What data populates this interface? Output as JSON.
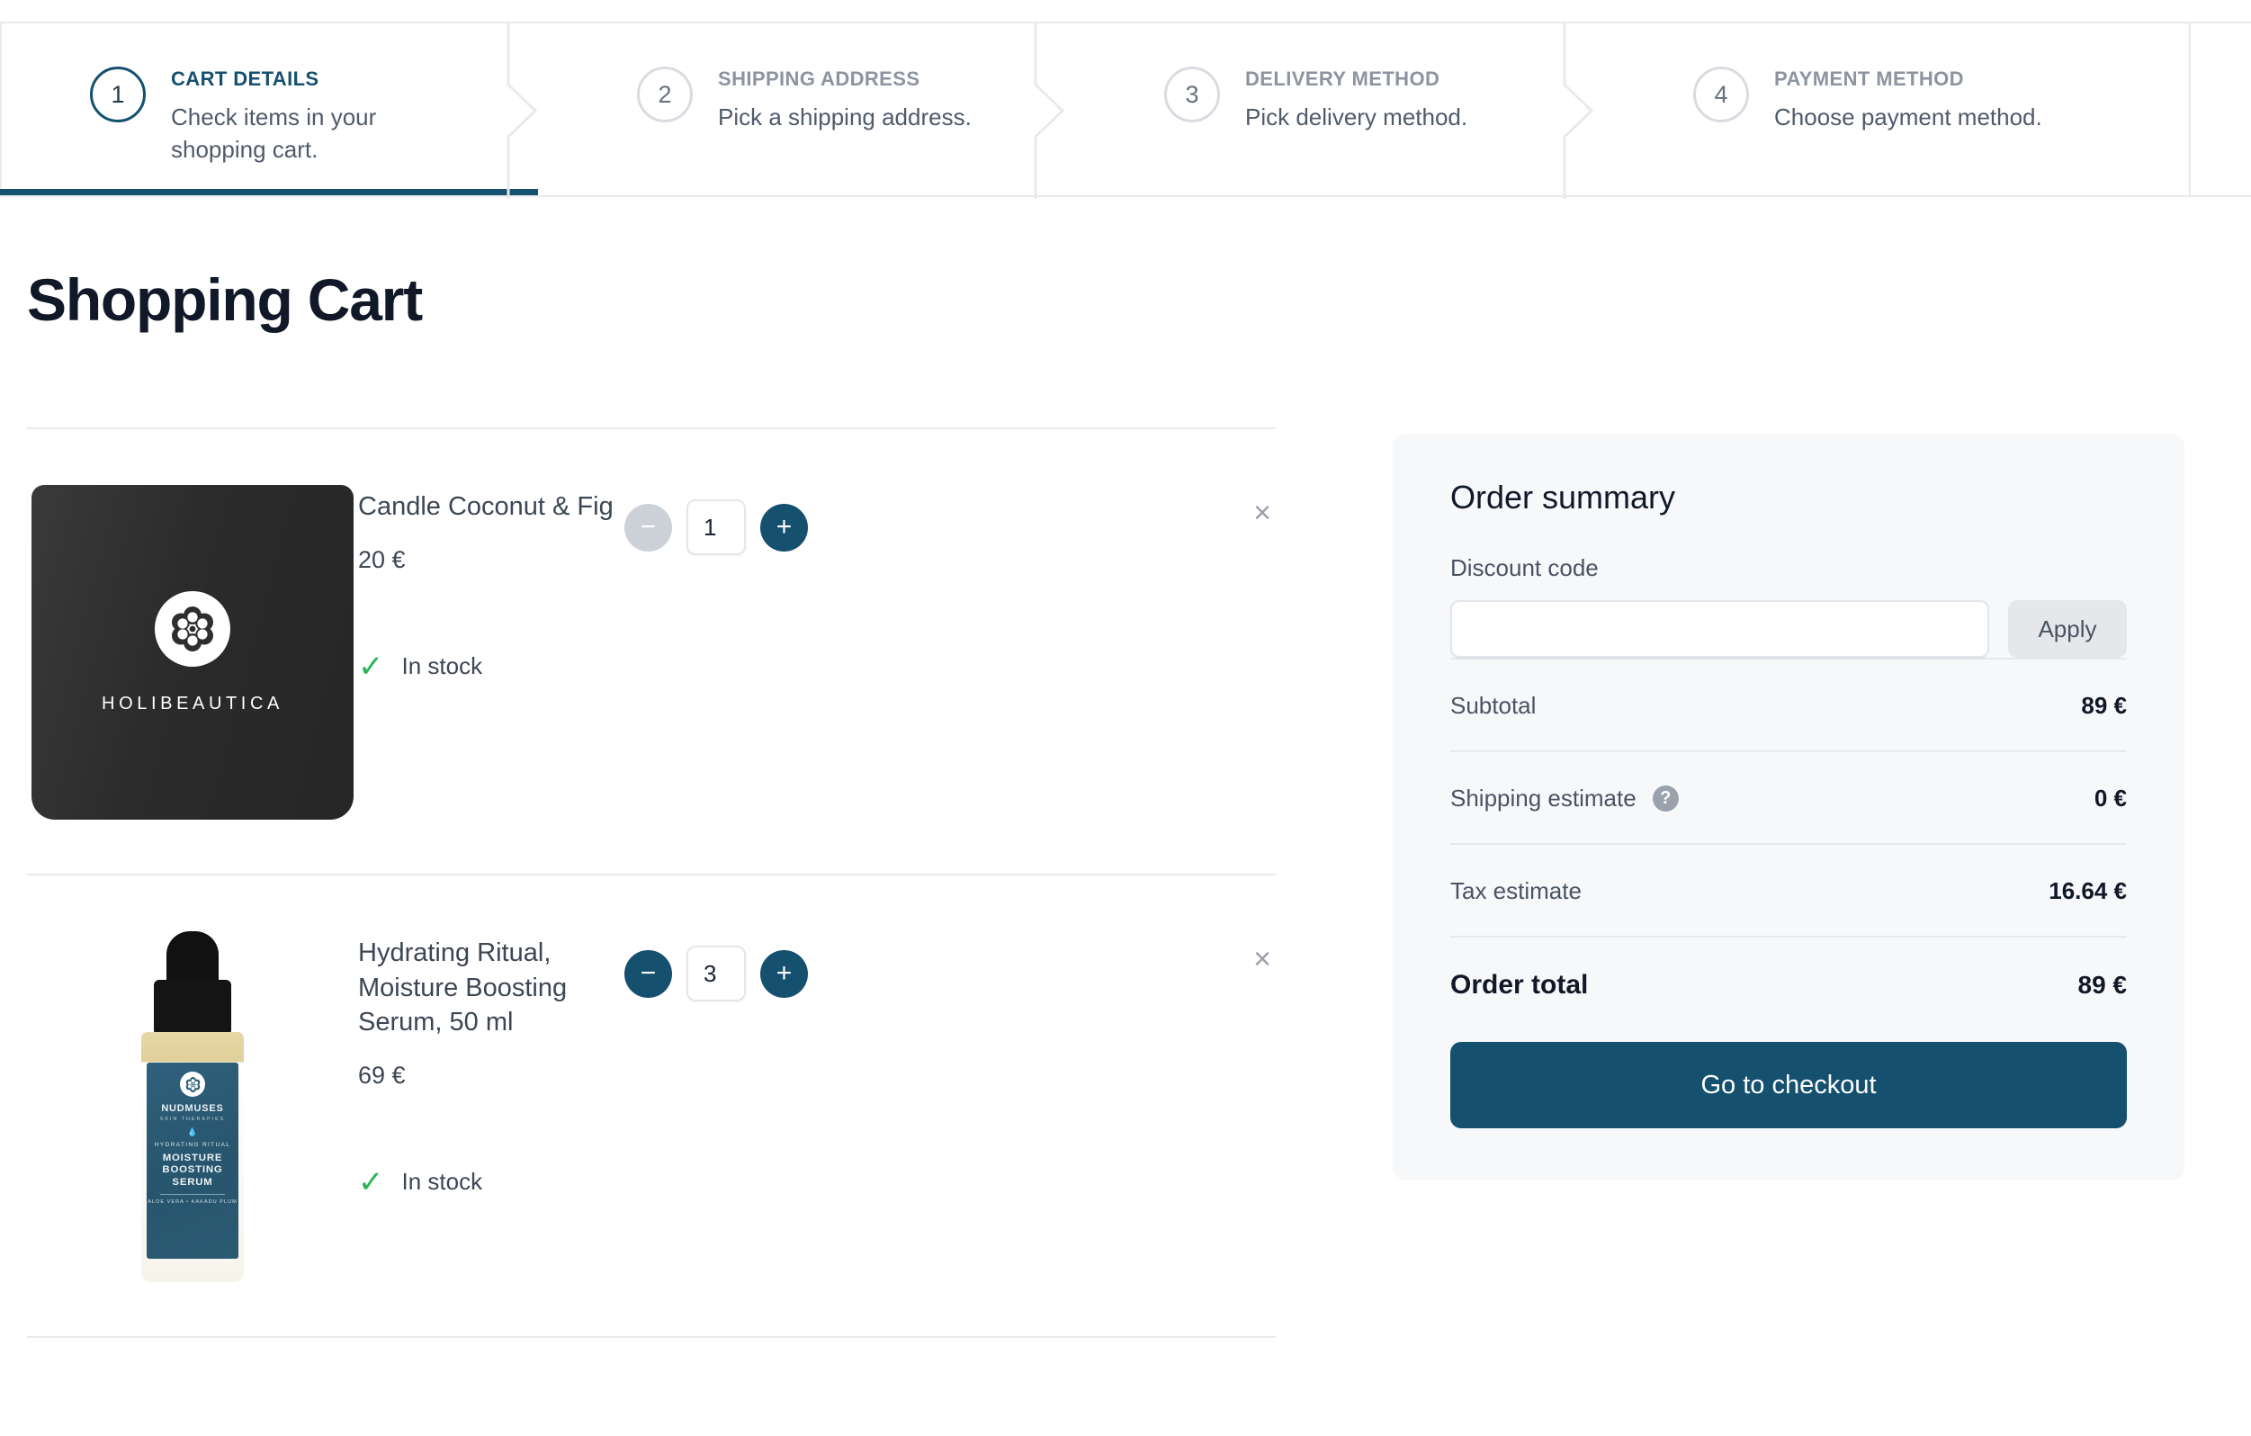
{
  "colors": {
    "accent": "#15506f",
    "panel_bg": "#f7f8fa",
    "heading": "#111827",
    "muted": "#8d949f",
    "in_stock": "#2bb556"
  },
  "stepper": {
    "steps": [
      {
        "number": "1",
        "title": "CART DETAILS",
        "description": "Check items in your shopping cart.",
        "state": "active"
      },
      {
        "number": "2",
        "title": "SHIPPING ADDRESS",
        "description": "Pick a shipping address.",
        "state": "inactive"
      },
      {
        "number": "3",
        "title": "DELIVERY METHOD",
        "description": "Pick delivery method.",
        "state": "inactive"
      },
      {
        "number": "4",
        "title": "PAYMENT METHOD",
        "description": "Choose payment method.",
        "state": "inactive"
      }
    ]
  },
  "page": {
    "title": "Shopping Cart"
  },
  "cart": {
    "items": [
      {
        "name": "Candle Coconut & Fig",
        "price": "20 €",
        "quantity": "1",
        "stock_label": "In stock",
        "decrement_label": "−",
        "increment_label": "+",
        "remove_label": "×",
        "image": {
          "kind": "candle",
          "brand": "HOLIBEAUTICA"
        }
      },
      {
        "name": "Hydrating Ritual, Moisture Boosting Serum, 50 ml",
        "price": "69 €",
        "quantity": "3",
        "stock_label": "In stock",
        "decrement_label": "−",
        "increment_label": "+",
        "remove_label": "×",
        "image": {
          "kind": "serum",
          "brand": "NUDMUSES",
          "sub_brand": "SKIN THERAPIES",
          "ritual": "HYDRATING RITUAL",
          "product": "MOISTURE BOOSTING SERUM",
          "ingredients": "ALOE VERA • KAKADU PLUM"
        }
      }
    ]
  },
  "summary": {
    "title": "Order summary",
    "discount_label": "Discount code",
    "discount_value": "",
    "discount_placeholder": "",
    "apply_label": "Apply",
    "rows": [
      {
        "label": "Subtotal",
        "value": "89 €",
        "help": false
      },
      {
        "label": "Shipping estimate",
        "value": "0 €",
        "help": true
      },
      {
        "label": "Tax estimate",
        "value": "16.64 €",
        "help": false
      }
    ],
    "total_label": "Order total",
    "total_value": "89 €",
    "checkout_label": "Go to checkout",
    "help_icon_label": "?"
  }
}
